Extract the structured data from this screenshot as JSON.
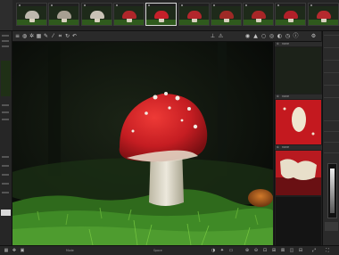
{
  "filmstrip": {
    "thumbnails": [
      {
        "cap_color": "#bdb7ad",
        "selected": false
      },
      {
        "cap_color": "#a79f92",
        "selected": false
      },
      {
        "cap_color": "#c9c2b6",
        "selected": false
      },
      {
        "cap_color": "#b0262a",
        "selected": false
      },
      {
        "cap_color": "#c5202a",
        "selected": true
      },
      {
        "cap_color": "#b3262c",
        "selected": false
      },
      {
        "cap_color": "#9e2a26",
        "selected": false
      },
      {
        "cap_color": "#a72627",
        "selected": false
      },
      {
        "cap_color": "#b12029",
        "selected": false
      },
      {
        "cap_color": "#b52a2e",
        "selected": false
      }
    ]
  },
  "toolbar": {
    "left_icons": [
      "menu-icon",
      "globe-icon",
      "settings-icon",
      "grid-icon",
      "edit-icon",
      "wand-icon",
      "crop-icon",
      "rotate-icon",
      "undo-icon"
    ],
    "right_icons": [
      "pin-icon",
      "warning-icon",
      "aperture-icon",
      "lock-icon",
      "circle-icon",
      "target-icon",
      "mask-icon",
      "history-icon",
      "info-icon",
      "settings-icon"
    ]
  },
  "right_column": {
    "items": [
      {
        "label": "none",
        "kind": "dark"
      },
      {
        "label": "none",
        "kind": "mushroom-top"
      },
      {
        "label": "none",
        "kind": "mushroom-side"
      }
    ]
  },
  "bottom_bar": {
    "left_icons": [
      "grid-icon",
      "pin-icon",
      "image-icon"
    ],
    "label_left": "Mode",
    "label_mid": "Space",
    "right_icons": [
      "contrast-icon",
      "star-icon",
      "zoom-in-icon",
      "zoom-out-icon",
      "fit-icon",
      "fill-icon",
      "lock-icon",
      "compare-icon",
      "split-icon",
      "expand-icon"
    ]
  },
  "colors": {
    "cap_red": "#c61f23",
    "moss_green": "#3f7a22",
    "background_dark": "#0c0f0a"
  }
}
